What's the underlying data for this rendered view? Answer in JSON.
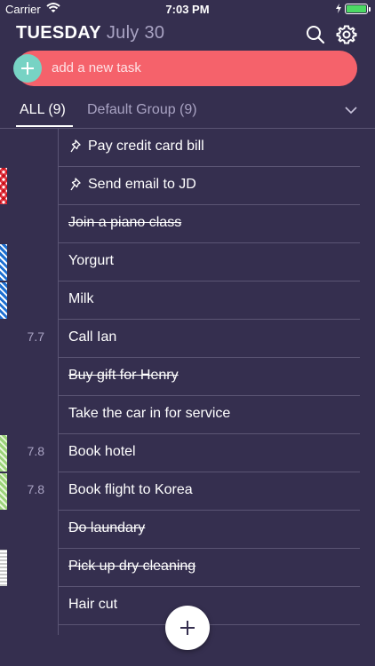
{
  "status": {
    "carrier": "Carrier",
    "time": "7:03 PM"
  },
  "header": {
    "day": "TUESDAY",
    "date": "July 30"
  },
  "add_task": {
    "placeholder": "add a new task"
  },
  "tabs": [
    {
      "label": "ALL (9)",
      "active": true
    },
    {
      "label": "Default Group (9)",
      "active": false
    }
  ],
  "tasks": [
    {
      "text": "Pay credit card bill",
      "date": "",
      "done": false,
      "pinned": true,
      "marker": ""
    },
    {
      "text": "Send email to JD",
      "date": "",
      "done": false,
      "pinned": true,
      "marker": "red"
    },
    {
      "text": "Join a piano class",
      "date": "",
      "done": true,
      "pinned": false,
      "marker": ""
    },
    {
      "text": "Yorgurt",
      "date": "",
      "done": false,
      "pinned": false,
      "marker": "blue"
    },
    {
      "text": "Milk",
      "date": "",
      "done": false,
      "pinned": false,
      "marker": "blue"
    },
    {
      "text": "Call Ian",
      "date": "7.7",
      "done": false,
      "pinned": false,
      "marker": ""
    },
    {
      "text": "Buy gift for Henry",
      "date": "",
      "done": true,
      "pinned": false,
      "marker": ""
    },
    {
      "text": "Take the car in for service",
      "date": "",
      "done": false,
      "pinned": false,
      "marker": ""
    },
    {
      "text": "Book hotel",
      "date": "7.8",
      "done": false,
      "pinned": false,
      "marker": "green"
    },
    {
      "text": "Book flight to Korea",
      "date": "7.8",
      "done": false,
      "pinned": false,
      "marker": "green"
    },
    {
      "text": "Do laundary",
      "date": "",
      "done": true,
      "pinned": false,
      "marker": ""
    },
    {
      "text": "Pick up dry cleaning",
      "date": "",
      "done": true,
      "pinned": false,
      "marker": "gray"
    },
    {
      "text": "Hair cut",
      "date": "",
      "done": false,
      "pinned": false,
      "marker": ""
    }
  ],
  "colors": {
    "background": "#352f4f",
    "add_bar": "#f5626b",
    "add_circle": "#77d3c4",
    "divider": "#5b5574",
    "muted_text": "#a9a3c3"
  },
  "icons": [
    "wifi-icon",
    "battery-icon",
    "search-icon",
    "gear-icon",
    "plus-icon",
    "chevron-down-icon",
    "pin-icon"
  ]
}
